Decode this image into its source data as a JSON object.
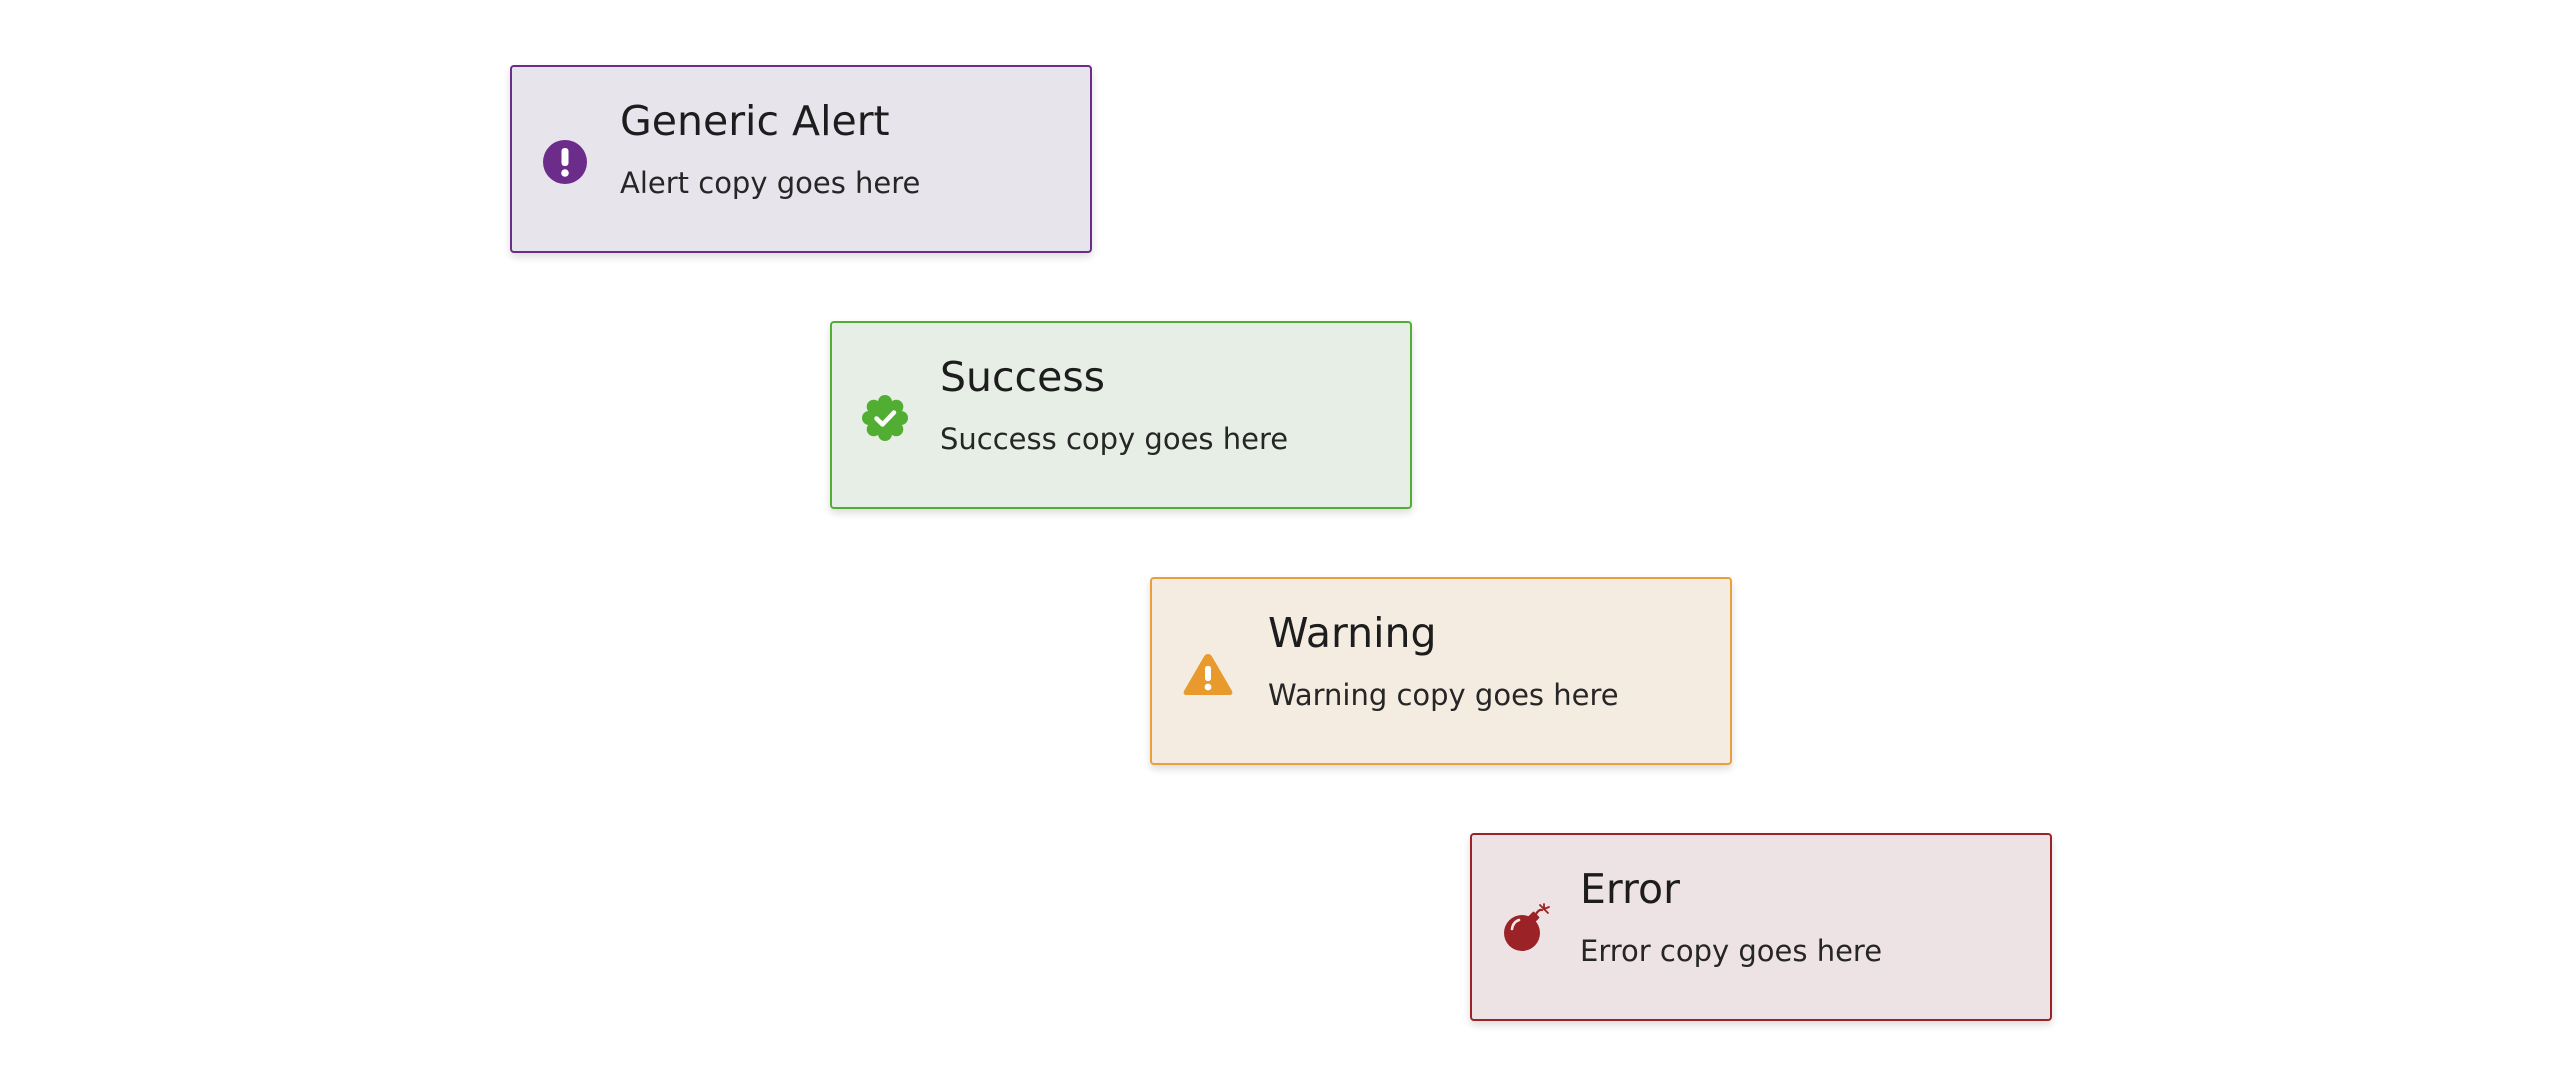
{
  "alerts": {
    "generic": {
      "title": "Generic Alert",
      "copy": "Alert copy goes here",
      "icon": "exclamation-circle-icon",
      "border_color": "#6b2c8a",
      "background_color": "#e8e4ec",
      "icon_color": "#6b2c8a"
    },
    "success": {
      "title": "Success",
      "copy": "Success copy goes here",
      "icon": "check-badge-icon",
      "border_color": "#52ae32",
      "background_color": "#e6eee5",
      "icon_color": "#52ae32"
    },
    "warning": {
      "title": "Warning",
      "copy": "Warning copy goes here",
      "icon": "warning-triangle-icon",
      "border_color": "#e8a03a",
      "background_color": "#f4ece1",
      "icon_color": "#e89a2c"
    },
    "error": {
      "title": "Error",
      "copy": "Error copy goes here",
      "icon": "bomb-icon",
      "border_color": "#9b2226",
      "background_color": "#ede3e4",
      "icon_color": "#9b2226"
    }
  }
}
